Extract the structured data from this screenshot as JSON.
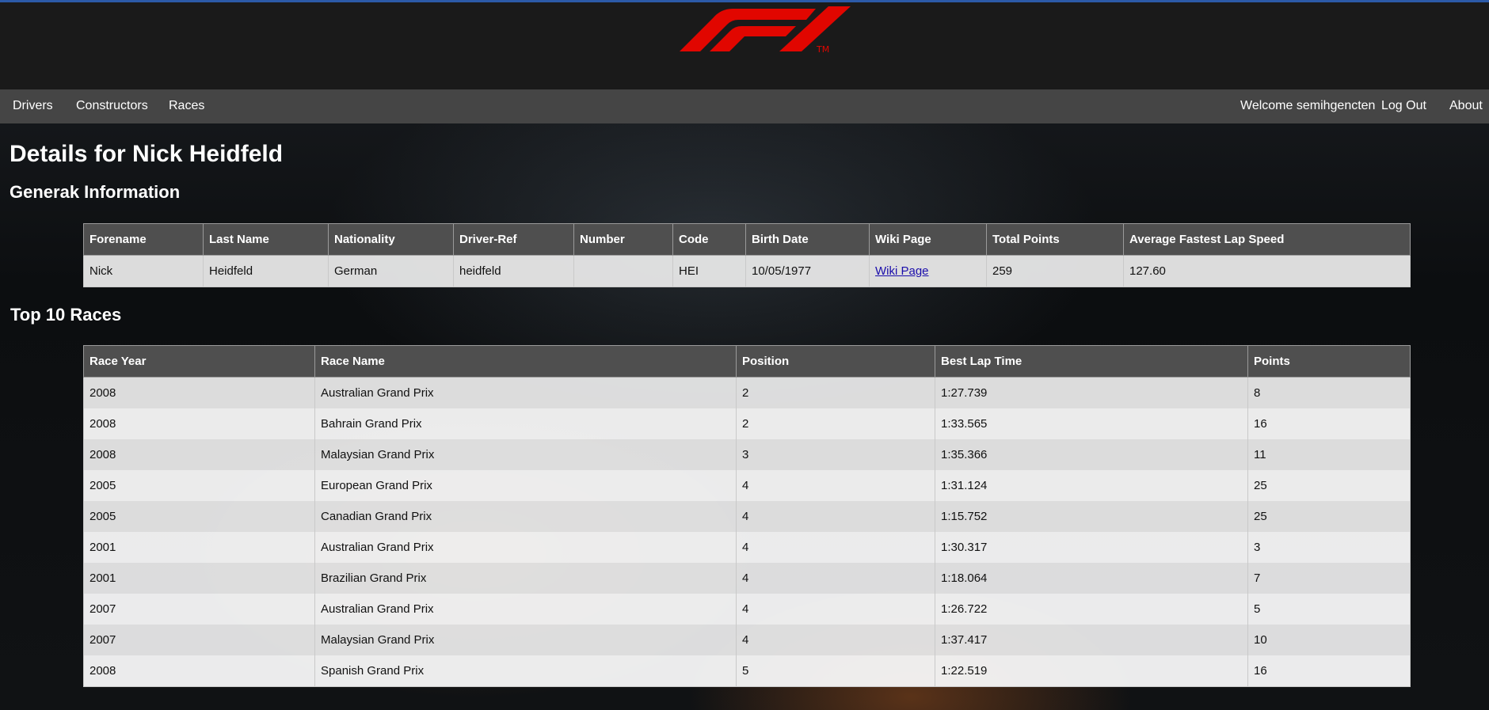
{
  "nav": {
    "left": [
      "Drivers",
      "Constructors",
      "Races"
    ],
    "welcome": "Welcome semihgencten",
    "logout": "Log Out",
    "about": "About"
  },
  "brand": {
    "logo_icon": "f1-logo-icon",
    "tm": "TM",
    "accent": "#e10600"
  },
  "page": {
    "title": "Details for Nick Heidfeld",
    "general_heading": "Generak Information",
    "races_heading": "Top 10 Races"
  },
  "general_table": {
    "headers": [
      "Forename",
      "Last Name",
      "Nationality",
      "Driver-Ref",
      "Number",
      "Code",
      "Birth Date",
      "Wiki Page",
      "Total Points",
      "Average Fastest Lap Speed"
    ],
    "row": {
      "forename": "Nick",
      "last_name": "Heidfeld",
      "nationality": "German",
      "driver_ref": "heidfeld",
      "number": "",
      "code": "HEI",
      "birth_date": "10/05/1977",
      "wiki_page": "Wiki Page",
      "total_points": "259",
      "avg_fastest_lap_speed": "127.60"
    }
  },
  "races_table": {
    "headers": [
      "Race Year",
      "Race Name",
      "Position",
      "Best Lap Time",
      "Points"
    ],
    "rows": [
      [
        "2008",
        "Australian Grand Prix",
        "2",
        "1:27.739",
        "8"
      ],
      [
        "2008",
        "Bahrain Grand Prix",
        "2",
        "1:33.565",
        "16"
      ],
      [
        "2008",
        "Malaysian Grand Prix",
        "3",
        "1:35.366",
        "11"
      ],
      [
        "2005",
        "European Grand Prix",
        "4",
        "1:31.124",
        "25"
      ],
      [
        "2005",
        "Canadian Grand Prix",
        "4",
        "1:15.752",
        "25"
      ],
      [
        "2001",
        "Australian Grand Prix",
        "4",
        "1:30.317",
        "3"
      ],
      [
        "2001",
        "Brazilian Grand Prix",
        "4",
        "1:18.064",
        "7"
      ],
      [
        "2007",
        "Australian Grand Prix",
        "4",
        "1:26.722",
        "5"
      ],
      [
        "2007",
        "Malaysian Grand Prix",
        "4",
        "1:37.417",
        "10"
      ],
      [
        "2008",
        "Spanish Grand Prix",
        "5",
        "1:22.519",
        "16"
      ]
    ]
  }
}
